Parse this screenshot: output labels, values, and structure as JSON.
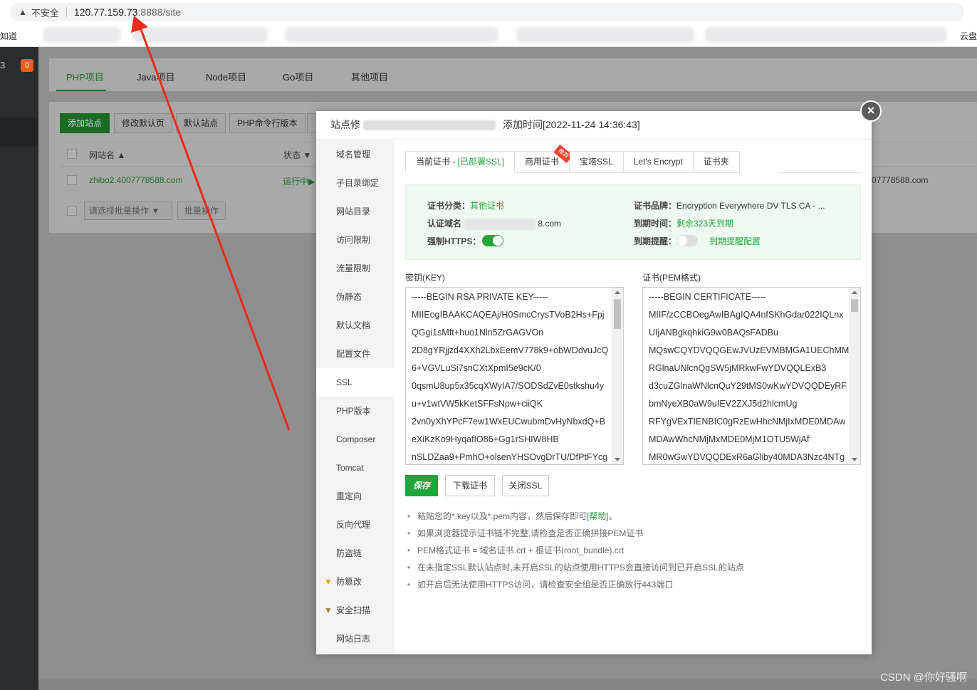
{
  "browser": {
    "insecure_label": "不安全",
    "url_host": "120.77.159.73",
    "url_rest": ":8888/site",
    "bookmark_left": "知道",
    "bookmark_right": "云盘"
  },
  "sidebar": {
    "number": "3",
    "badge": "0"
  },
  "project_tabs": [
    "PHP项目",
    "Java项目",
    "Node项目",
    "Go项目",
    "其他项目"
  ],
  "toolbar": {
    "add_site": "添加站点",
    "edit_default_page": "修改默认页",
    "default_site": "默认站点",
    "php_cli": "PHP命令行版本"
  },
  "site_table": {
    "headers": {
      "name": "网站名 ▲",
      "status": "状态 ▼"
    },
    "row": {
      "name": "zhibo2.4007778588.com",
      "status": "运行中▶",
      "domain_tail": "07778588.com"
    },
    "batch_placeholder": "请选择批量操作",
    "batch_button": "批量操作"
  },
  "modal": {
    "title_prefix": "站点修",
    "title_added": "添加时间[2022-11-24 14:36:43]",
    "close": "×",
    "nav": [
      "域名管理",
      "子目录绑定",
      "网站目录",
      "访问限制",
      "流量限制",
      "伪静态",
      "默认文档",
      "配置文件",
      "SSL",
      "PHP版本",
      "Composer",
      "Tomcat",
      "重定向",
      "反向代理",
      "防盗链",
      "防篡改",
      "安全扫描",
      "网站日志"
    ],
    "nav_active": "SSL",
    "cert_tabs": {
      "current": "当前证书 - ",
      "current_status": "[已部署SSL]",
      "commercial": "商用证书",
      "ribbon": "推荐",
      "baota": "宝塔SSL",
      "letsencrypt": "Let's Encrypt",
      "folder": "证书夹"
    },
    "info": {
      "category_label": "证书分类：",
      "category_value": "其他证书",
      "domain_label": "认证域名",
      "domain_value": "8.com",
      "https_label": "强制HTTPS：",
      "brand_label": "证书品牌：",
      "brand_value": "Encryption Everywhere DV TLS CA - ...",
      "expire_label": "到期时间：",
      "expire_value": "剩余323天到期",
      "remind_label": "到期提醒：",
      "remind_link": "到期提醒配置"
    },
    "key_label": "密钥(KEY)",
    "cert_label": "证书(PEM格式)",
    "key_lines": [
      "-----BEGIN RSA PRIVATE KEY-----",
      "MIIEogIBAAKCAQEAj/H0SmcCrysTVoB2Hs+Fpj",
      "QGgi1sMft+huo1Nln5ZrGAGVOn",
      "2D8gYRjjzd4XXh2LbxEemV778k9+obWDdvuJcQ",
      "6+VGVLuSi7snCXtXpmI5e9cK/0",
      "0qsmU8up5x35cqXWyIA7/SODSdZvE0stkshu4y",
      "u+v1wtVW5kKetSFFsNpw+ciiQK",
      "2vn0yXhYPcF7ew1WxEUCwubmDvHyNbxdQ+B",
      "eXiKzKo9HyqafIO86+Gg1rSHIW8HB",
      "nSLDZaa9+PmhO+olsenYHSOvgDrTU/DfPtFYcg"
    ],
    "cert_lines": [
      "-----BEGIN CERTIFICATE-----",
      "MIIF/zCCBOegAwIBAgIQA4nfSKhGdar022IQLnx",
      "UIjANBgkqhkiG9w0BAQsFADBu",
      "MQswCQYDVQQGEwJVUzEVMBMGA1UEChMM",
      "RGlnaUNlcnQgSW5jMRkwFwYDVQQLExB3",
      "d3cuZGlnaWNlcnQuY29tMS0wKwYDVQQDEyRF",
      "bmNyeXB0aW9uIEV2ZXJ5d2hlcmUg",
      "RFYgVExTIENBIC0gRzEwHhcNMjIxMDE0MDAw",
      "MDAwWhcNMjMxMDE0MjM1OTU5WjAf",
      "MR0wGwYDVQQDExR6aGliby40MDA3Nzc4NTg"
    ],
    "buttons": {
      "save": "保存",
      "download": "下载证书",
      "close_ssl": "关闭SSL"
    },
    "tips": [
      {
        "text": "粘贴您的*.key以及*.pem内容，然后保存即可",
        "link": "[帮助]",
        "end": "。"
      },
      {
        "text": "如果浏览器提示证书链不完整,请检查是否正确拼接PEM证书"
      },
      {
        "text": "PEM格式证书 = 域名证书.crt + 根证书(root_bundle).crt"
      },
      {
        "text": "在未指定SSL默认站点时,未开启SSL的站点使用HTTPS会直接访问到已开启SSL的站点"
      },
      {
        "text": "如开启后无法使用HTTPS访问，请检查安全组是否正确放行443端口"
      }
    ]
  },
  "watermark": "CSDN @你好骚啊",
  "colors": {
    "accent": "#20a53a",
    "arrow": "#ee2a1b",
    "badge": "#e85d17"
  }
}
